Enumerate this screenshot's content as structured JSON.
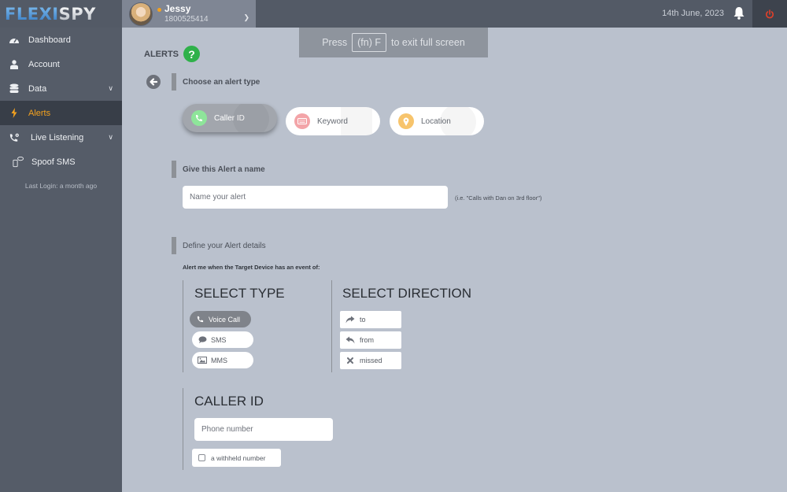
{
  "brand": {
    "part1": "FLEXI",
    "part2": "SPY"
  },
  "user": {
    "name": "Jessy",
    "phone": "1800525414",
    "status_color": "#f4a21f"
  },
  "header": {
    "date": "14th June, 2023"
  },
  "sidebar": {
    "items": [
      {
        "label": "Dashboard",
        "icon": "dashboard-icon",
        "active": false,
        "has_chevron": false
      },
      {
        "label": "Account",
        "icon": "user-icon",
        "active": false,
        "has_chevron": false
      },
      {
        "label": "Data",
        "icon": "database-icon",
        "active": false,
        "has_chevron": true
      },
      {
        "label": "Alerts",
        "icon": "bolt-icon",
        "active": true,
        "has_chevron": false
      },
      {
        "label": "Live Listening",
        "icon": "phone-gear-icon",
        "active": false,
        "has_chevron": true
      },
      {
        "label": "Spoof SMS",
        "icon": "phone-message-icon",
        "active": false,
        "has_chevron": false
      }
    ],
    "last_login": "Last Login: a month ago"
  },
  "fullscreen_notice": {
    "press": "Press",
    "key": "(fn) F",
    "rest": "to exit full screen"
  },
  "page": {
    "title": "ALERTS",
    "help": "?",
    "sections": {
      "choose_type": "Choose an alert type",
      "give_name": "Give this Alert a name",
      "define_details": "Define your Alert details"
    },
    "alert_types": [
      {
        "label": "Caller ID",
        "icon": "phone-icon",
        "color": "#8ee59a",
        "selected": true
      },
      {
        "label": "Keyword",
        "icon": "keyboard-icon",
        "color": "#f3a4a8",
        "selected": false
      },
      {
        "label": "Location",
        "icon": "map-pin-icon",
        "color": "#f7c46c",
        "selected": false
      }
    ],
    "name_input": {
      "placeholder": "Name your alert",
      "value": ""
    },
    "name_hint": "(i.e. \"Calls with Dan on 3rd floor\")",
    "alert_me": "Alert me when the Target Device has an event of:",
    "select_type": {
      "title": "SELECT TYPE",
      "options": [
        {
          "label": "Voice Call",
          "icon": "phone-icon",
          "selected": true
        },
        {
          "label": "SMS",
          "icon": "speech-bubble-icon",
          "selected": false
        },
        {
          "label": "MMS",
          "icon": "image-icon",
          "selected": false
        }
      ]
    },
    "select_direction": {
      "title": "SELECT DIRECTION",
      "options": [
        {
          "label": "to",
          "icon": "share-arrow-icon"
        },
        {
          "label": "from",
          "icon": "reply-arrow-icon"
        },
        {
          "label": "missed",
          "icon": "x-icon"
        }
      ]
    },
    "caller_id": {
      "title": "CALLER ID",
      "phone_placeholder": "Phone number",
      "phone_value": "",
      "withheld_label": "a withheld number",
      "withheld_checked": false
    }
  },
  "colors": {
    "accent": "#f4a21f",
    "help_green": "#2fb14a",
    "power_red": "#e0402a"
  }
}
